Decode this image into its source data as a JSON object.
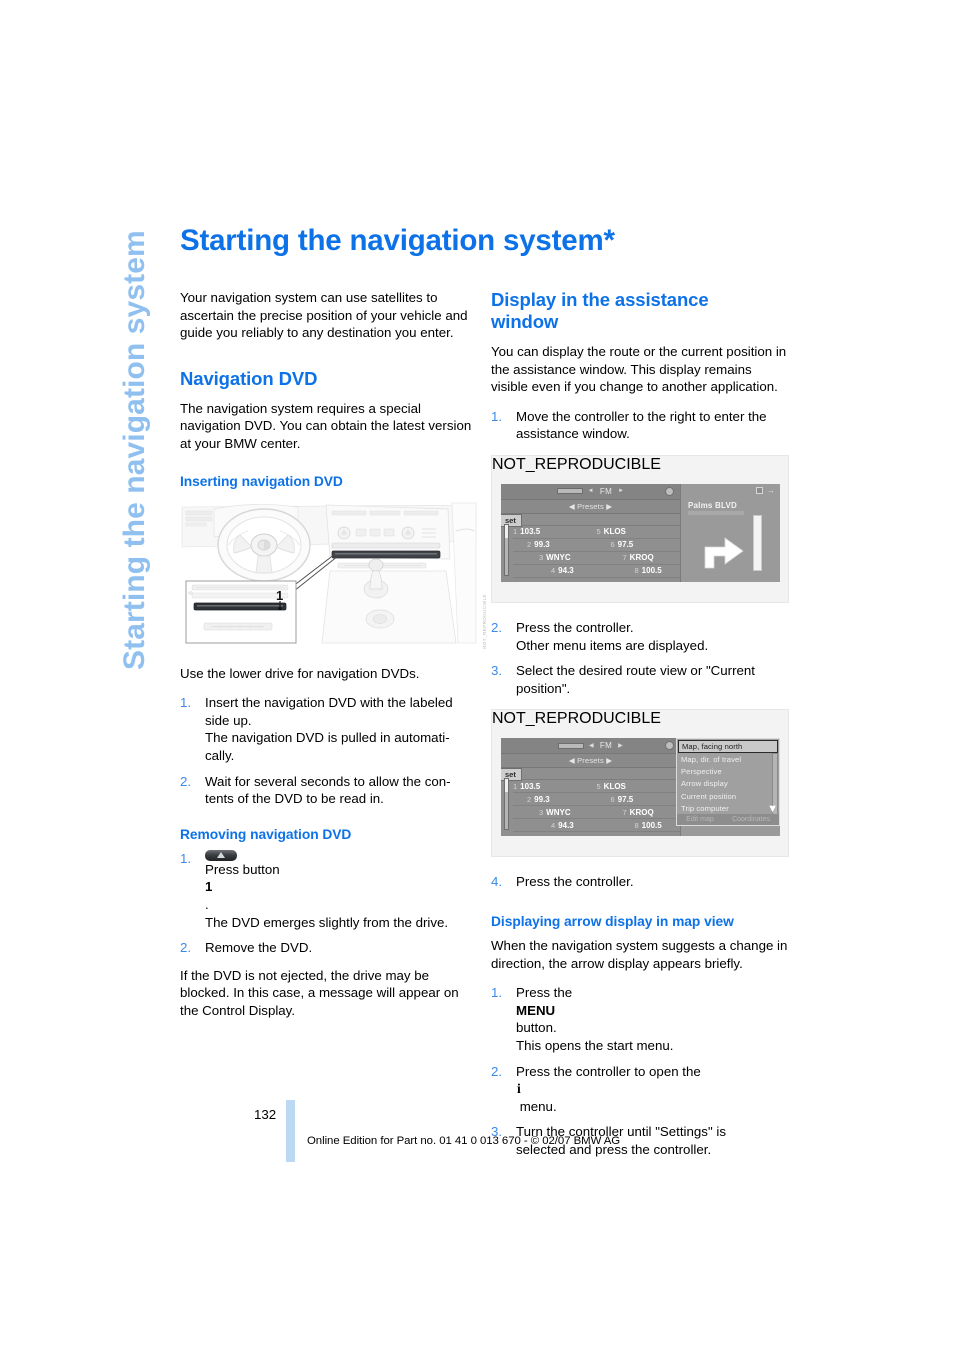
{
  "running_head": "Starting the navigation system",
  "title": "Starting the navigation system*",
  "colors": {
    "heading_blue": "#0d72e8",
    "running_head_blue": "#8fc0f0",
    "step_number_blue": "#3c8ae8",
    "footer_bar_blue": "#bcd9f4"
  },
  "left_column": {
    "intro": "Your navigation system can use satellites to ascertain the precise position of your vehicle and guide you reliably to any destination you enter.",
    "section_navigation_dvd": {
      "heading": "Navigation DVD",
      "body": "The navigation system requires a special navigation DVD. You can obtain the latest version at your BMW center.",
      "sub_inserting": {
        "heading": "Inserting navigation DVD",
        "figure_callout": "1",
        "figure_credit": "NOT_REPRODUCIBLE",
        "caption": "Use the lower drive for navigation DVDs.",
        "steps": [
          {
            "num": "1.",
            "lines": [
              "Insert the navigation DVD with the labeled",
              "side up.",
              "The navigation DVD is pulled in automati-",
              "cally."
            ]
          },
          {
            "num": "2.",
            "lines": [
              "Wait for several seconds to allow the con-",
              "tents of the DVD to be read in."
            ]
          }
        ]
      },
      "sub_removing": {
        "heading": "Removing navigation DVD",
        "steps": [
          {
            "num": "1.",
            "icon": "eject-button-icon",
            "lines": [
              "Press button 1.",
              "The DVD emerges slightly from the drive."
            ]
          },
          {
            "num": "2.",
            "lines": [
              "Remove the DVD."
            ]
          }
        ],
        "note": "If the DVD is not ejected, the drive may be blocked. In this case, a message will appear on the Control Display."
      }
    }
  },
  "right_column": {
    "section_assistance": {
      "heading_line1": "Display in the assistance",
      "heading_line2": "window",
      "body": "You can display the route or the current position in the assistance window. This display remains visible even if you change to another application.",
      "steps_before_fig1": [
        {
          "num": "1.",
          "lines": [
            "Move the controller to the right to enter the",
            "assistance window."
          ]
        }
      ],
      "steps_after_fig1": [
        {
          "num": "2.",
          "lines": [
            "Press the controller.",
            "Other menu items are displayed."
          ]
        },
        {
          "num": "3.",
          "lines": [
            "Select the desired route view or \"Current",
            "position\"."
          ]
        }
      ],
      "steps_after_fig2": [
        {
          "num": "4.",
          "lines": [
            "Press the controller."
          ]
        }
      ]
    },
    "section_arrow_display": {
      "heading": "Displaying arrow display in map view",
      "body": "When the navigation system suggests a change in direction, the arrow display appears briefly.",
      "steps": [
        {
          "num": "1.",
          "lines_rich": [
            {
              "parts": [
                {
                  "t": "Press the ",
                  "b": false
                },
                {
                  "t": "MENU",
                  "b": true
                },
                {
                  "t": " button.",
                  "b": false
                }
              ]
            },
            {
              "parts": [
                {
                  "t": "This opens the start menu.",
                  "b": false
                }
              ]
            }
          ]
        },
        {
          "num": "2.",
          "lines_rich": [
            {
              "parts": [
                {
                  "t": "Press the controller to open the ",
                  "b": false
                },
                {
                  "t": "i",
                  "b": true,
                  "glyph": true
                },
                {
                  "t": " menu.",
                  "b": false
                }
              ]
            }
          ]
        },
        {
          "num": "3.",
          "lines_rich": [
            {
              "parts": [
                {
                  "t": "Turn the controller until \"Settings\" is",
                  "b": false
                }
              ]
            },
            {
              "parts": [
                {
                  "t": "selected and press the controller.",
                  "b": false
                }
              ]
            }
          ]
        }
      ]
    }
  },
  "control_display_1": {
    "credit": "NOT_REPRODUCIBLE",
    "radio": {
      "band": "FM",
      "arrow_left": "◄",
      "arrow_right": "►",
      "presets_label": "Presets",
      "set_label": "set",
      "presets": [
        {
          "num": "1",
          "value": "103.5"
        },
        {
          "num": "5",
          "value": "KLOS"
        },
        {
          "num": "2",
          "value": "99.3"
        },
        {
          "num": "6",
          "value": "97.5"
        },
        {
          "num": "3",
          "value": "WNYC"
        },
        {
          "num": "7",
          "value": "KROQ"
        },
        {
          "num": "4",
          "value": "94.3"
        },
        {
          "num": "8",
          "value": "100.5"
        }
      ]
    },
    "assistance": {
      "street": "Palms BLVD",
      "arrow": "turn-right-arrow-icon"
    }
  },
  "control_display_2": {
    "credit": "NOT_REPRODUCIBLE",
    "radio": {
      "band": "FM",
      "presets_label": "Presets",
      "set_label": "set",
      "presets": [
        {
          "num": "1",
          "value": "103.5"
        },
        {
          "num": "5",
          "value": "KLOS"
        },
        {
          "num": "2",
          "value": "99.3"
        },
        {
          "num": "6",
          "value": "97.5"
        },
        {
          "num": "3",
          "value": "WNYC"
        },
        {
          "num": "7",
          "value": "KROQ"
        },
        {
          "num": "4",
          "value": "94.3"
        },
        {
          "num": "8",
          "value": "100.5"
        }
      ]
    },
    "menu": {
      "selected": "Map, facing north",
      "items": [
        "Map, dir. of travel",
        "Perspective",
        "Arrow display",
        "Current position",
        "Trip computer"
      ],
      "footer_left": "Edit map",
      "footer_right": "Coordinates"
    }
  },
  "footer": {
    "page_number": "132",
    "text": "Online Edition for Part no. 01 41 0 013 670 - © 02/07 BMW AG"
  }
}
